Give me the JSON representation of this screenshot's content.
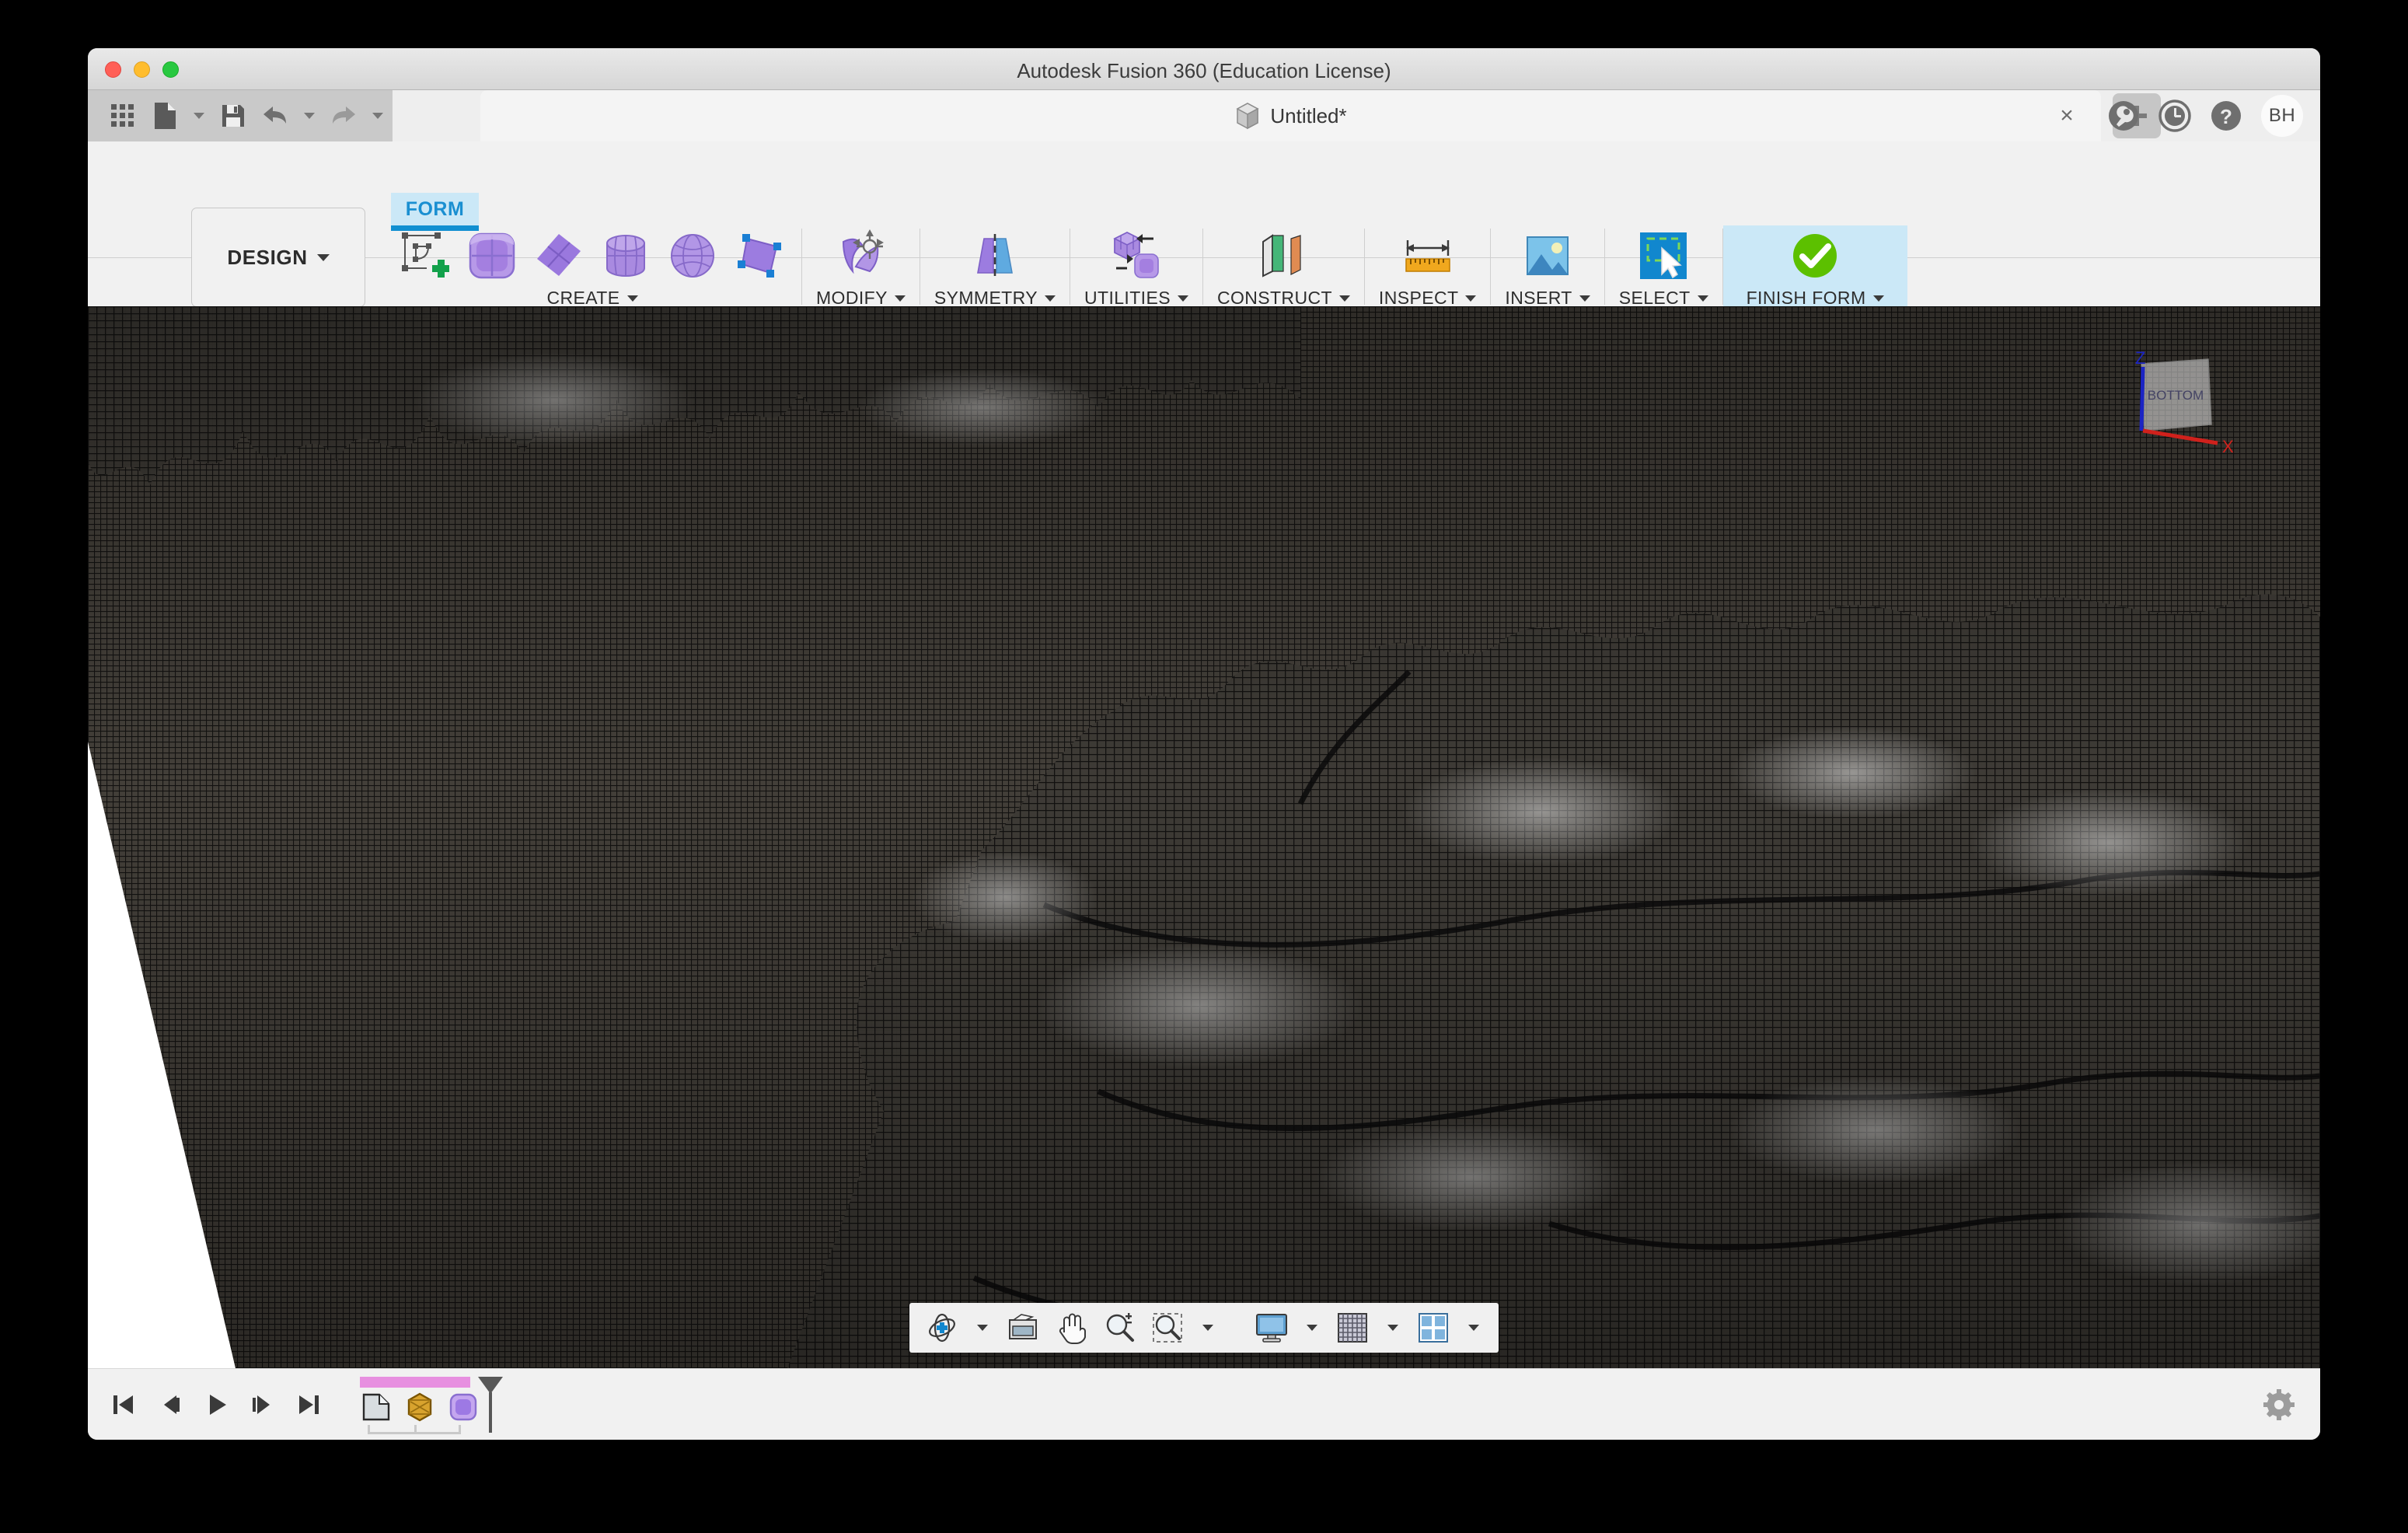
{
  "window": {
    "title": "Autodesk Fusion 360 (Education License)",
    "traffic_lights": [
      "close",
      "minimize",
      "maximize"
    ]
  },
  "quick_access": {
    "items": [
      {
        "name": "app-grid",
        "icon": "grid-icon",
        "has_caret": false
      },
      {
        "name": "new-document",
        "icon": "file-icon",
        "has_caret": true
      },
      {
        "name": "save",
        "icon": "save-icon",
        "has_caret": false
      },
      {
        "name": "undo",
        "icon": "undo-icon",
        "has_caret": true
      },
      {
        "name": "redo",
        "icon": "redo-icon",
        "has_caret": true
      }
    ]
  },
  "document_tab": {
    "label": "Untitled*",
    "icon": "cube-icon",
    "close_label": "×",
    "new_tab_label": "+"
  },
  "account_bar": {
    "items": [
      {
        "name": "job-status",
        "icon": "wrench-icon"
      },
      {
        "name": "history",
        "icon": "clock-icon"
      },
      {
        "name": "help",
        "icon": "question-icon"
      }
    ],
    "avatar_initials": "BH"
  },
  "ribbon": {
    "workspace_label": "DESIGN",
    "tabs": [
      {
        "label": "FORM",
        "active": true
      }
    ],
    "panels": [
      {
        "label": "CREATE",
        "has_caret": true,
        "highlighted": false,
        "icons": [
          "create-form-icon",
          "box-icon",
          "plane-icon",
          "cylinder-icon",
          "sphere-icon",
          "quadball-icon"
        ]
      },
      {
        "label": "MODIFY",
        "has_caret": true,
        "highlighted": false,
        "icons": [
          "edit-form-icon"
        ]
      },
      {
        "label": "SYMMETRY",
        "has_caret": true,
        "highlighted": false,
        "icons": [
          "mirror-internal-icon"
        ]
      },
      {
        "label": "UTILITIES",
        "has_caret": true,
        "highlighted": false,
        "icons": [
          "convert-icon"
        ]
      },
      {
        "label": "CONSTRUCT",
        "has_caret": true,
        "highlighted": false,
        "icons": [
          "offset-plane-icon"
        ]
      },
      {
        "label": "INSPECT",
        "has_caret": true,
        "highlighted": false,
        "icons": [
          "measure-icon"
        ]
      },
      {
        "label": "INSERT",
        "has_caret": true,
        "highlighted": false,
        "icons": [
          "insert-image-icon"
        ]
      },
      {
        "label": "SELECT",
        "has_caret": true,
        "highlighted": false,
        "icons": [
          "select-window-icon"
        ]
      },
      {
        "label": "FINISH FORM",
        "has_caret": true,
        "highlighted": true,
        "icons": [
          "green-check-icon"
        ]
      }
    ]
  },
  "viewport": {
    "model_description": "dense wireframe sculpted terrain mesh",
    "background_color": "#ffffff",
    "mesh_color": "#3a3833",
    "viewcube": {
      "face_label": "BOTTOM",
      "axis_x_label": "X",
      "axis_z_label": "Z",
      "axis_x_color": "#d0211c",
      "axis_z_color": "#1b24c4"
    }
  },
  "navbar": {
    "items": [
      {
        "name": "orbit",
        "icon": "orbit-icon",
        "has_caret": true
      },
      {
        "name": "look-at",
        "icon": "look-at-icon",
        "has_caret": false
      },
      {
        "name": "pan",
        "icon": "pan-hand-icon",
        "has_caret": false
      },
      {
        "name": "zoom",
        "icon": "zoom-icon",
        "has_caret": false
      },
      {
        "name": "zoom-window",
        "icon": "zoom-window-icon",
        "has_caret": true
      },
      {
        "name": "display-settings",
        "icon": "monitor-icon",
        "has_caret": true
      },
      {
        "name": "grid-snaps",
        "icon": "grid-settings-icon",
        "has_caret": true
      },
      {
        "name": "viewport-layout",
        "icon": "viewport-layout-icon",
        "has_caret": true
      }
    ]
  },
  "timeline": {
    "playback": [
      {
        "name": "go-to-beginning",
        "icon": "skip-start-icon"
      },
      {
        "name": "step-back",
        "icon": "step-back-icon"
      },
      {
        "name": "play",
        "icon": "play-icon"
      },
      {
        "name": "step-forward",
        "icon": "step-forward-icon"
      },
      {
        "name": "go-to-end",
        "icon": "skip-end-icon"
      }
    ],
    "group_bar_color": "#e78fe0",
    "nodes": [
      {
        "name": "sketch-feature",
        "icon": "sketch-icon"
      },
      {
        "name": "box-feature",
        "icon": "crate-icon"
      },
      {
        "name": "form-feature",
        "icon": "form-cube-icon"
      }
    ],
    "marker": "playhead"
  },
  "status": {
    "settings_icon": "gear-icon"
  }
}
